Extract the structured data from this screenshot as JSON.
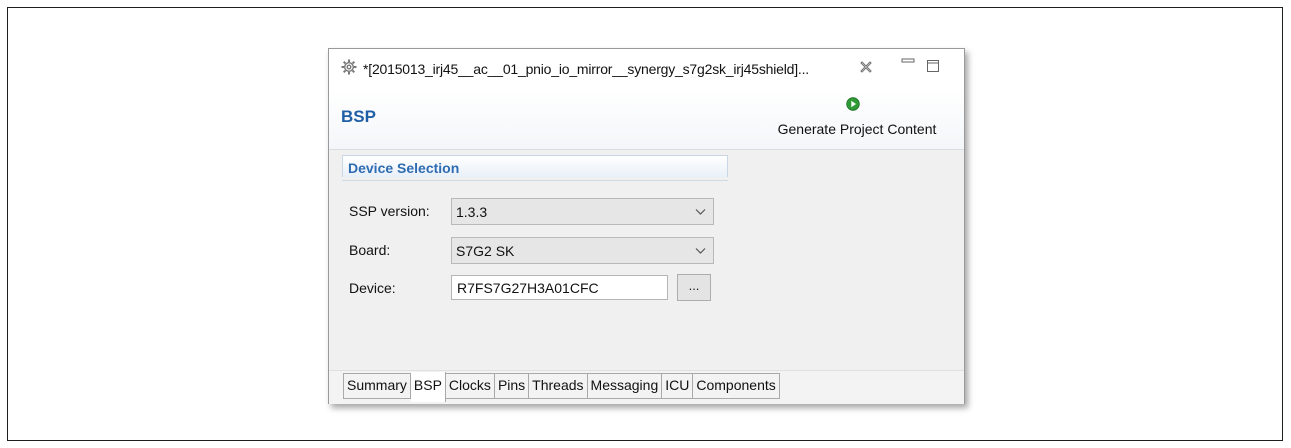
{
  "window": {
    "title": "*[2015013_irj45__ac__01_pnio_io_mirror__synergy_s7g2sk_irj45shield]..."
  },
  "header": {
    "title": "BSP",
    "generate_label": "Generate Project Content"
  },
  "device_selection": {
    "section_title": "Device Selection",
    "ssp_version_label": "SSP version:",
    "ssp_version_value": "1.3.3",
    "board_label": "Board:",
    "board_value": "S7G2 SK",
    "device_label": "Device:",
    "device_value": "R7FS7G27H3A01CFC",
    "browse_label": "..."
  },
  "tabs": [
    {
      "label": "Summary"
    },
    {
      "label": "BSP"
    },
    {
      "label": "Clocks"
    },
    {
      "label": "Pins"
    },
    {
      "label": "Threads"
    },
    {
      "label": "Messaging"
    },
    {
      "label": "ICU"
    },
    {
      "label": "Components"
    }
  ],
  "active_tab": "BSP",
  "colors": {
    "title_blue": "#1f5fa6",
    "section_blue": "#2e6cb2",
    "play_green": "#2f9a36"
  },
  "icons": [
    "gear-icon",
    "close-tab-icon",
    "minimize-icon",
    "maximize-icon",
    "play-icon",
    "chevron-down-icon"
  ]
}
